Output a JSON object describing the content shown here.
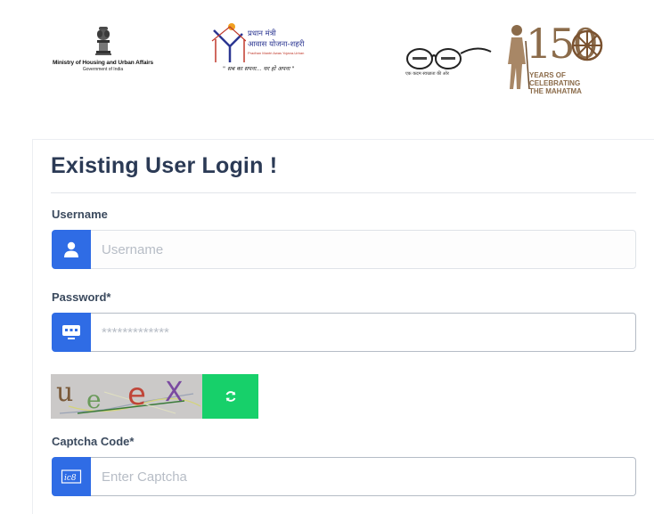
{
  "logos": {
    "ministry": {
      "name": "Ministry of Housing and Urban Affairs",
      "sub": "Government of India"
    },
    "pmay": {
      "line1": "प्रधान मंत्री",
      "line2": "आवास योजना-शहरी",
      "line3": "Pradhan Mantri Awas Yojana-Urban",
      "tagline": "\" सब का सपना... घर हो अपना \""
    },
    "swachh_bharat": {
      "tagline": "एक कदम स्वच्छता की ओर"
    },
    "gandhi150": {
      "number": "150",
      "line1": "YEARS OF",
      "line2": "CELEBRATING",
      "line3": "THE MAHATMA"
    }
  },
  "login": {
    "title": "Existing User Login !",
    "username": {
      "label": "Username",
      "placeholder": "Username",
      "icon": "user-icon"
    },
    "password": {
      "label": "Password*",
      "placeholder": "*************",
      "icon": "keyboard-icon"
    },
    "captcha": {
      "image_text": "ueeX",
      "refresh_icon": "refresh-icon",
      "label": "Captcha Code*",
      "placeholder": "Enter Captcha",
      "icon": "captcha-icon"
    }
  },
  "colors": {
    "accent_blue": "#2f6ce5",
    "refresh_green": "#17d06a",
    "title_text": "#2b3a55",
    "label_text": "#3b4a5e"
  }
}
